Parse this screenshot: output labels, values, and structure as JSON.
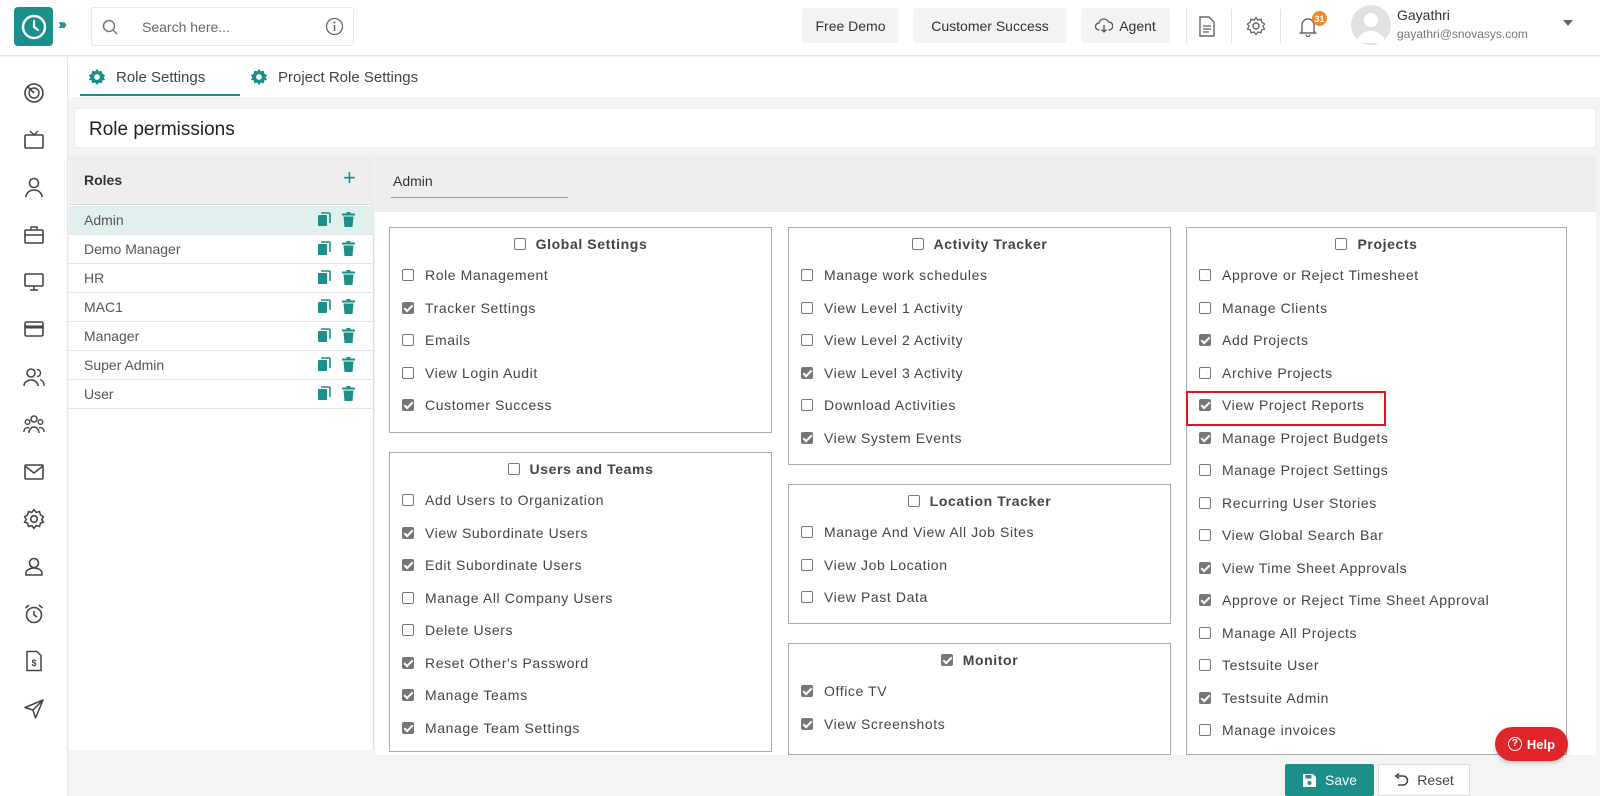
{
  "header": {
    "search_placeholder": "Search here...",
    "buttons": {
      "free_demo": "Free Demo",
      "customer_success": "Customer Success",
      "agent": "Agent"
    },
    "notification_count": "31",
    "user": {
      "name": "Gayathri",
      "email": "gayathri@snovasys.com"
    }
  },
  "tabs": [
    {
      "label": "Role Settings",
      "active": true
    },
    {
      "label": "Project Role Settings",
      "active": false
    }
  ],
  "page_title": "Role permissions",
  "roles": {
    "title": "Roles",
    "items": [
      {
        "name": "Admin",
        "selected": true
      },
      {
        "name": "Demo Manager",
        "selected": false
      },
      {
        "name": "HR",
        "selected": false
      },
      {
        "name": "MAC1",
        "selected": false
      },
      {
        "name": "Manager",
        "selected": false
      },
      {
        "name": "Super Admin",
        "selected": false
      },
      {
        "name": "User",
        "selected": false
      }
    ]
  },
  "selected_role": "Admin",
  "groups": {
    "global_settings": {
      "title": "Global Settings",
      "checked": false,
      "items": [
        {
          "label": "Role Management",
          "checked": false
        },
        {
          "label": "Tracker Settings",
          "checked": true
        },
        {
          "label": "Emails",
          "checked": false
        },
        {
          "label": "View Login Audit",
          "checked": false
        },
        {
          "label": "Customer Success",
          "checked": true
        }
      ]
    },
    "users_and_teams": {
      "title": "Users and Teams",
      "checked": false,
      "items": [
        {
          "label": "Add Users to Organization",
          "checked": false
        },
        {
          "label": "View Subordinate Users",
          "checked": true
        },
        {
          "label": "Edit Subordinate Users",
          "checked": true
        },
        {
          "label": "Manage All Company Users",
          "checked": false
        },
        {
          "label": "Delete Users",
          "checked": false
        },
        {
          "label": "Reset Other's Password",
          "checked": true
        },
        {
          "label": "Manage Teams",
          "checked": true
        },
        {
          "label": "Manage Team Settings",
          "checked": true
        }
      ]
    },
    "activity_tracker": {
      "title": "Activity Tracker",
      "checked": false,
      "items": [
        {
          "label": "Manage work schedules",
          "checked": false
        },
        {
          "label": "View Level 1 Activity",
          "checked": false
        },
        {
          "label": "View Level 2 Activity",
          "checked": false
        },
        {
          "label": "View Level 3 Activity",
          "checked": true
        },
        {
          "label": "Download Activities",
          "checked": false
        },
        {
          "label": "View System Events",
          "checked": true
        }
      ]
    },
    "location_tracker": {
      "title": "Location Tracker",
      "checked": false,
      "items": [
        {
          "label": "Manage And View All Job Sites",
          "checked": false
        },
        {
          "label": "View Job Location",
          "checked": false
        },
        {
          "label": "View Past Data",
          "checked": false
        }
      ]
    },
    "monitor": {
      "title": "Monitor",
      "checked": true,
      "items": [
        {
          "label": "Office TV",
          "checked": true
        },
        {
          "label": "View Screenshots",
          "checked": true
        }
      ]
    },
    "projects": {
      "title": "Projects",
      "checked": false,
      "items": [
        {
          "label": "Approve or Reject Timesheet",
          "checked": false
        },
        {
          "label": "Manage Clients",
          "checked": false
        },
        {
          "label": "Add Projects",
          "checked": true
        },
        {
          "label": "Archive Projects",
          "checked": false
        },
        {
          "label": "View Project Reports",
          "checked": true
        },
        {
          "label": "Manage Project Budgets",
          "checked": true
        },
        {
          "label": "Manage Project Settings",
          "checked": false
        },
        {
          "label": "Recurring User Stories",
          "checked": false
        },
        {
          "label": "View Global Search Bar",
          "checked": false
        },
        {
          "label": "View Time Sheet Approvals",
          "checked": true
        },
        {
          "label": "Approve or Reject Time Sheet Approval",
          "checked": true
        },
        {
          "label": "Manage All Projects",
          "checked": false
        },
        {
          "label": "Testsuite User",
          "checked": false
        },
        {
          "label": "Testsuite Admin",
          "checked": true
        },
        {
          "label": "Manage invoices",
          "checked": false
        }
      ]
    }
  },
  "actions": {
    "save": "Save",
    "reset": "Reset",
    "help": "Help"
  },
  "colors": {
    "brand": "#1b8f8a",
    "highlight": "#e0161b",
    "help": "#e0252b"
  }
}
